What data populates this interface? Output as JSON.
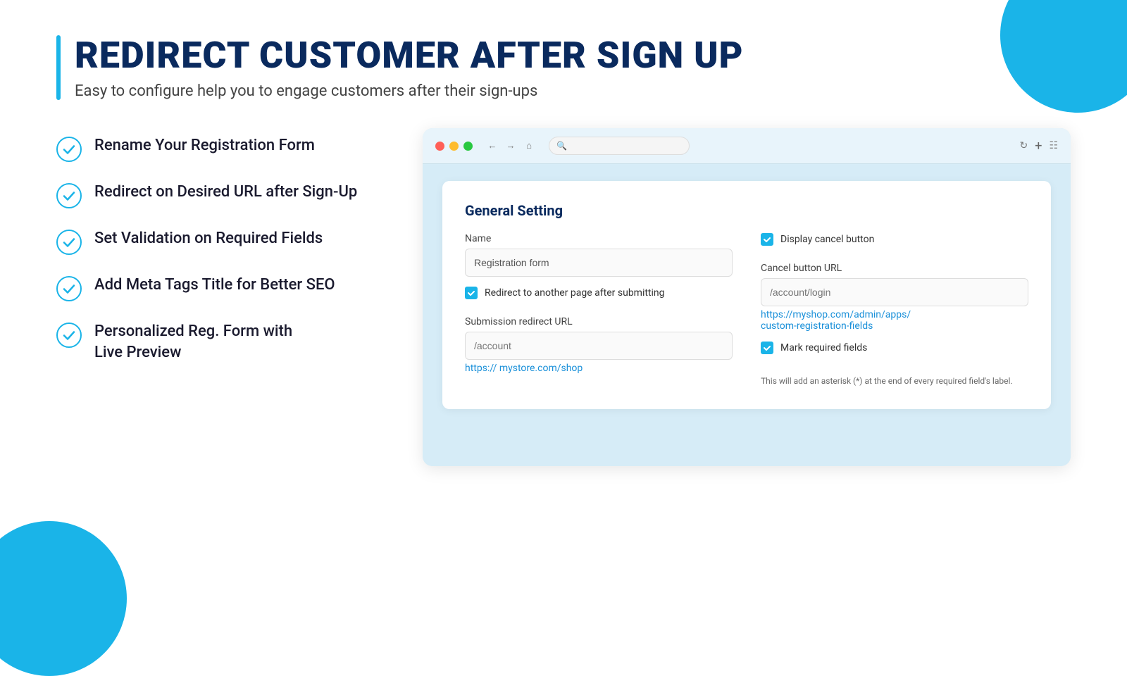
{
  "page": {
    "title": "REDIRECT CUSTOMER AFTER SIGN UP",
    "subtitle": "Easy to configure help you to engage customers after their sign-ups"
  },
  "features": [
    {
      "id": "rename",
      "text": "Rename Your Registration Form"
    },
    {
      "id": "redirect",
      "text": "Redirect on Desired URL after Sign-Up"
    },
    {
      "id": "validation",
      "text": "Set Validation on Required Fields"
    },
    {
      "id": "metatags",
      "text": "Add Meta Tags Title for Better SEO"
    },
    {
      "id": "personalized",
      "text": "Personalized Reg. Form with\nLive Preview"
    }
  ],
  "browser": {
    "search_placeholder": "Q"
  },
  "card": {
    "title": "General Setting",
    "name_label": "Name",
    "name_value": "Registration form",
    "redirect_checkbox_label": "Redirect to another page after  submitting",
    "redirect_url_label": "Submission redirect URL",
    "redirect_url_placeholder": "/account",
    "redirect_url_link": "https:// mystore.com/shop",
    "display_cancel_label": "Display cancel button",
    "cancel_url_label": "Cancel button URL",
    "cancel_url_placeholder": "/account/login",
    "admin_link": "https://myshop.com/admin/apps/\ncustom-registration-fields",
    "mark_required_label": "Mark required fields",
    "mark_required_hint": "This will add an asterisk (*) at the end of every required field's label."
  }
}
